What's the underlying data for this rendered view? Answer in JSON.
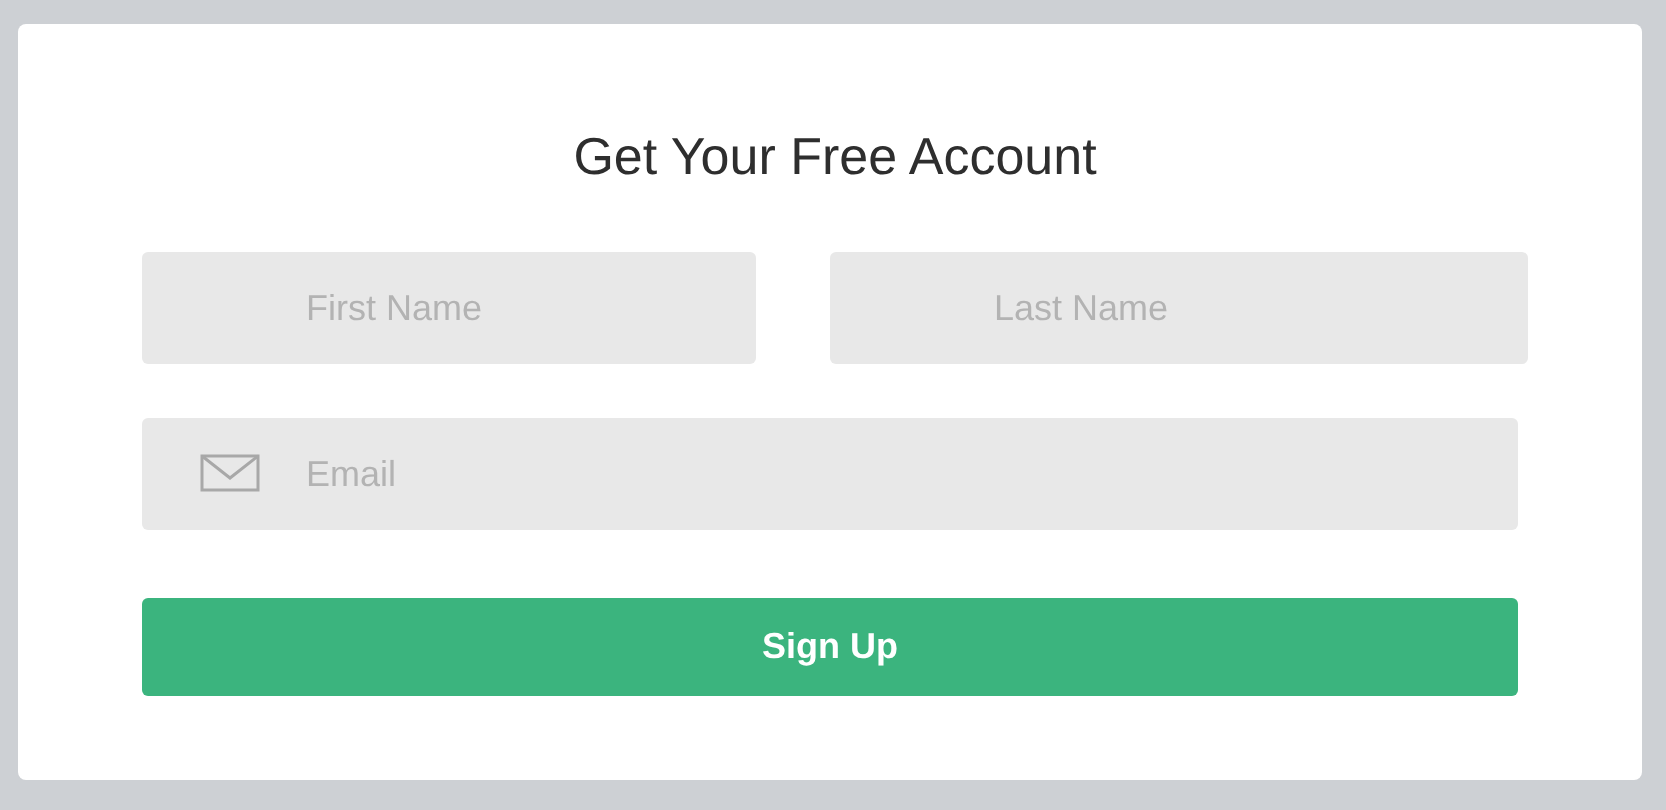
{
  "title": "Get Your Free Account",
  "fields": [
    {
      "kind": "text",
      "placeholder": "First Name"
    },
    {
      "kind": "text",
      "placeholder": "Last Name"
    },
    {
      "kind": "email",
      "placeholder": "Email"
    }
  ],
  "button": "Sign Up"
}
